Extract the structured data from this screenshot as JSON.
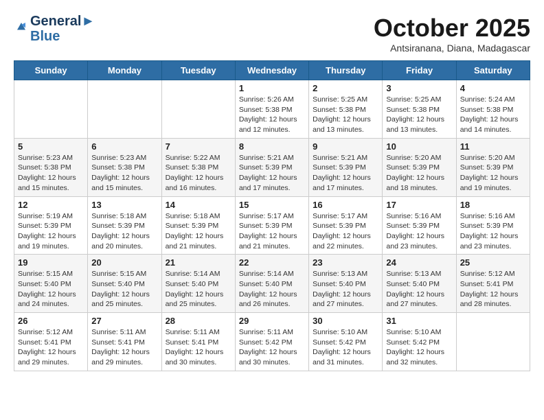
{
  "logo": {
    "line1": "General",
    "line2": "Blue"
  },
  "title": "October 2025",
  "subtitle": "Antsiranana, Diana, Madagascar",
  "days_of_week": [
    "Sunday",
    "Monday",
    "Tuesday",
    "Wednesday",
    "Thursday",
    "Friday",
    "Saturday"
  ],
  "weeks": [
    [
      {
        "day": "",
        "info": ""
      },
      {
        "day": "",
        "info": ""
      },
      {
        "day": "",
        "info": ""
      },
      {
        "day": "1",
        "info": "Sunrise: 5:26 AM\nSunset: 5:38 PM\nDaylight: 12 hours\nand 12 minutes."
      },
      {
        "day": "2",
        "info": "Sunrise: 5:25 AM\nSunset: 5:38 PM\nDaylight: 12 hours\nand 13 minutes."
      },
      {
        "day": "3",
        "info": "Sunrise: 5:25 AM\nSunset: 5:38 PM\nDaylight: 12 hours\nand 13 minutes."
      },
      {
        "day": "4",
        "info": "Sunrise: 5:24 AM\nSunset: 5:38 PM\nDaylight: 12 hours\nand 14 minutes."
      }
    ],
    [
      {
        "day": "5",
        "info": "Sunrise: 5:23 AM\nSunset: 5:38 PM\nDaylight: 12 hours\nand 15 minutes."
      },
      {
        "day": "6",
        "info": "Sunrise: 5:23 AM\nSunset: 5:38 PM\nDaylight: 12 hours\nand 15 minutes."
      },
      {
        "day": "7",
        "info": "Sunrise: 5:22 AM\nSunset: 5:38 PM\nDaylight: 12 hours\nand 16 minutes."
      },
      {
        "day": "8",
        "info": "Sunrise: 5:21 AM\nSunset: 5:39 PM\nDaylight: 12 hours\nand 17 minutes."
      },
      {
        "day": "9",
        "info": "Sunrise: 5:21 AM\nSunset: 5:39 PM\nDaylight: 12 hours\nand 17 minutes."
      },
      {
        "day": "10",
        "info": "Sunrise: 5:20 AM\nSunset: 5:39 PM\nDaylight: 12 hours\nand 18 minutes."
      },
      {
        "day": "11",
        "info": "Sunrise: 5:20 AM\nSunset: 5:39 PM\nDaylight: 12 hours\nand 19 minutes."
      }
    ],
    [
      {
        "day": "12",
        "info": "Sunrise: 5:19 AM\nSunset: 5:39 PM\nDaylight: 12 hours\nand 19 minutes."
      },
      {
        "day": "13",
        "info": "Sunrise: 5:18 AM\nSunset: 5:39 PM\nDaylight: 12 hours\nand 20 minutes."
      },
      {
        "day": "14",
        "info": "Sunrise: 5:18 AM\nSunset: 5:39 PM\nDaylight: 12 hours\nand 21 minutes."
      },
      {
        "day": "15",
        "info": "Sunrise: 5:17 AM\nSunset: 5:39 PM\nDaylight: 12 hours\nand 21 minutes."
      },
      {
        "day": "16",
        "info": "Sunrise: 5:17 AM\nSunset: 5:39 PM\nDaylight: 12 hours\nand 22 minutes."
      },
      {
        "day": "17",
        "info": "Sunrise: 5:16 AM\nSunset: 5:39 PM\nDaylight: 12 hours\nand 23 minutes."
      },
      {
        "day": "18",
        "info": "Sunrise: 5:16 AM\nSunset: 5:39 PM\nDaylight: 12 hours\nand 23 minutes."
      }
    ],
    [
      {
        "day": "19",
        "info": "Sunrise: 5:15 AM\nSunset: 5:40 PM\nDaylight: 12 hours\nand 24 minutes."
      },
      {
        "day": "20",
        "info": "Sunrise: 5:15 AM\nSunset: 5:40 PM\nDaylight: 12 hours\nand 25 minutes."
      },
      {
        "day": "21",
        "info": "Sunrise: 5:14 AM\nSunset: 5:40 PM\nDaylight: 12 hours\nand 25 minutes."
      },
      {
        "day": "22",
        "info": "Sunrise: 5:14 AM\nSunset: 5:40 PM\nDaylight: 12 hours\nand 26 minutes."
      },
      {
        "day": "23",
        "info": "Sunrise: 5:13 AM\nSunset: 5:40 PM\nDaylight: 12 hours\nand 27 minutes."
      },
      {
        "day": "24",
        "info": "Sunrise: 5:13 AM\nSunset: 5:40 PM\nDaylight: 12 hours\nand 27 minutes."
      },
      {
        "day": "25",
        "info": "Sunrise: 5:12 AM\nSunset: 5:41 PM\nDaylight: 12 hours\nand 28 minutes."
      }
    ],
    [
      {
        "day": "26",
        "info": "Sunrise: 5:12 AM\nSunset: 5:41 PM\nDaylight: 12 hours\nand 29 minutes."
      },
      {
        "day": "27",
        "info": "Sunrise: 5:11 AM\nSunset: 5:41 PM\nDaylight: 12 hours\nand 29 minutes."
      },
      {
        "day": "28",
        "info": "Sunrise: 5:11 AM\nSunset: 5:41 PM\nDaylight: 12 hours\nand 30 minutes."
      },
      {
        "day": "29",
        "info": "Sunrise: 5:11 AM\nSunset: 5:42 PM\nDaylight: 12 hours\nand 30 minutes."
      },
      {
        "day": "30",
        "info": "Sunrise: 5:10 AM\nSunset: 5:42 PM\nDaylight: 12 hours\nand 31 minutes."
      },
      {
        "day": "31",
        "info": "Sunrise: 5:10 AM\nSunset: 5:42 PM\nDaylight: 12 hours\nand 32 minutes."
      },
      {
        "day": "",
        "info": ""
      }
    ]
  ]
}
